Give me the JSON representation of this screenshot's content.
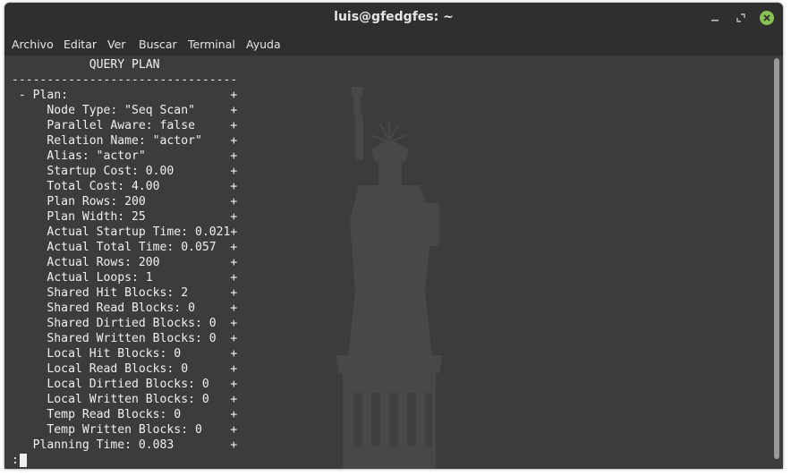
{
  "window": {
    "title": "luis@gfedgfes: ~"
  },
  "controls": {
    "minimize_icon": "minimize-icon",
    "maximize_icon": "maximize-icon",
    "close_icon": "close-icon",
    "close_color": "#8cc153"
  },
  "menu": {
    "items": [
      "Archivo",
      "Editar",
      "Ver",
      "Buscar",
      "Terminal",
      "Ayuda"
    ]
  },
  "terminal": {
    "lines": [
      "           QUERY PLAN",
      "--------------------------------",
      " - Plan:                       +",
      "     Node Type: \"Seq Scan\"     +",
      "     Parallel Aware: false     +",
      "     Relation Name: \"actor\"    +",
      "     Alias: \"actor\"            +",
      "     Startup Cost: 0.00        +",
      "     Total Cost: 4.00          +",
      "     Plan Rows: 200            +",
      "     Plan Width: 25            +",
      "     Actual Startup Time: 0.021+",
      "     Actual Total Time: 0.057  +",
      "     Actual Rows: 200          +",
      "     Actual Loops: 1           +",
      "     Shared Hit Blocks: 2      +",
      "     Shared Read Blocks: 0     +",
      "     Shared Dirtied Blocks: 0  +",
      "     Shared Written Blocks: 0  +",
      "     Local Hit Blocks: 0       +",
      "     Local Read Blocks: 0      +",
      "     Local Dirtied Blocks: 0   +",
      "     Local Written Blocks: 0   +",
      "     Temp Read Blocks: 0       +",
      "     Temp Written Blocks: 0    +",
      "   Planning Time: 0.083        +"
    ],
    "prompt": ":"
  },
  "colors": {
    "terminal_bg": "#3c3c3c",
    "titlebar_bg": "#2f2f2f",
    "text": "#f0f0f0"
  }
}
